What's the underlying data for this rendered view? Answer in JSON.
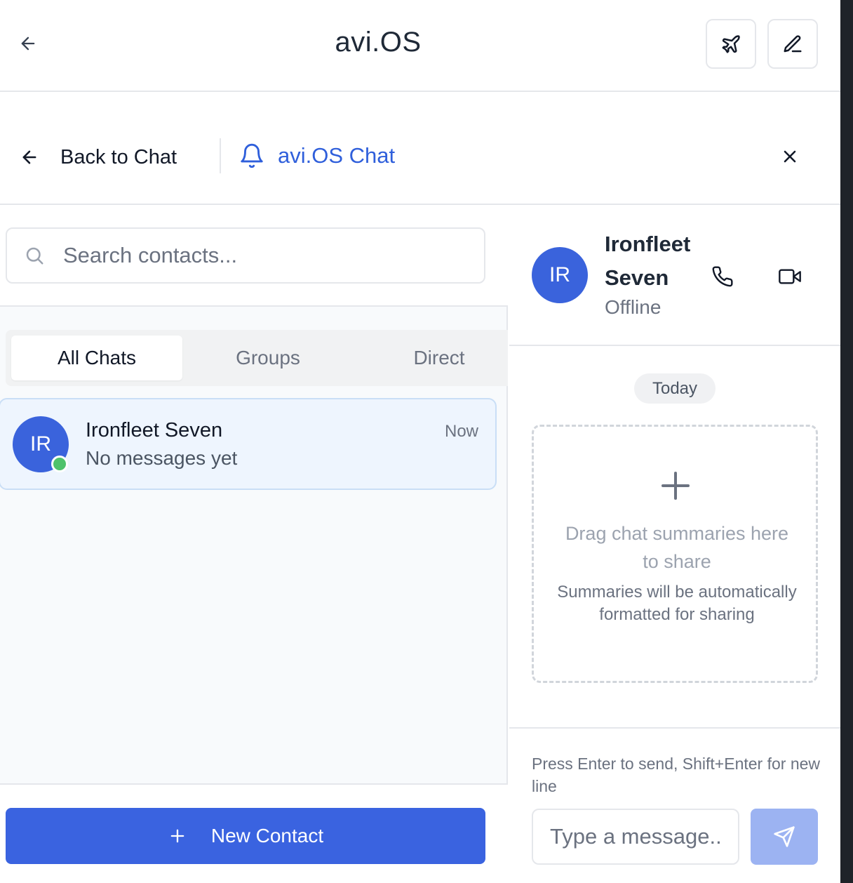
{
  "app": {
    "title": "avi.OS"
  },
  "subheader": {
    "back_label": "Back to Chat",
    "chat_label": "avi.OS Chat"
  },
  "search": {
    "placeholder": "Search contacts..."
  },
  "tabs": [
    {
      "label": "All Chats",
      "active": true
    },
    {
      "label": "Groups",
      "active": false
    },
    {
      "label": "Direct",
      "active": false
    }
  ],
  "contacts": [
    {
      "initials": "IR",
      "name": "Ironfleet Seven",
      "last_message": "No messages yet",
      "time": "Now",
      "online": true
    }
  ],
  "new_contact_label": "New Contact",
  "conversation": {
    "initials": "IR",
    "name": "Ironfleet Seven",
    "status": "Offline",
    "date_divider": "Today",
    "dropzone": {
      "title": "Drag chat summaries here to share",
      "subtitle": "Summaries will be automatically formatted for sharing"
    },
    "hint": "Press Enter to send, Shift+Enter for new line",
    "input_placeholder": "Type a message..."
  },
  "colors": {
    "accent": "#3a63e0",
    "avatar": "#3a63dc",
    "online": "#4ec26b",
    "send_disabled": "#9cb3f2",
    "selected_row": "#eef5fe"
  },
  "icons": [
    "back-arrow-icon",
    "plane-icon",
    "edit-icon",
    "bell-icon",
    "close-icon",
    "search-icon",
    "phone-icon",
    "video-icon",
    "plus-icon",
    "send-icon"
  ]
}
